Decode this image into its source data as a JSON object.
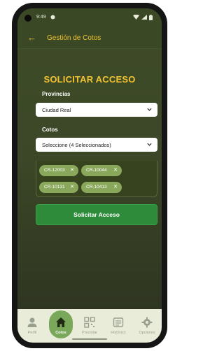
{
  "status_bar": {
    "time": "9:49",
    "network_icon": "signal-icon",
    "battery_icon": "battery-icon"
  },
  "app_bar": {
    "title": "Gestión de Cotos",
    "back_icon": "arrow-left-icon"
  },
  "form": {
    "headline": "SOLICITAR ACCESO",
    "provincias_label": "Provincias",
    "provincia_value": "Ciudad Real",
    "cotos_label": "Cotos",
    "cotos_value": "Seleccione (4 Seleccionados)",
    "selected_cotos": [
      "CR-12003",
      "CR-10044",
      "CR-10131",
      "CR-10413"
    ],
    "submit_label": "Solicitar Acceso"
  },
  "bottom_nav": {
    "items": [
      {
        "label": "Perfil",
        "icon": "person-icon",
        "active": false
      },
      {
        "label": "Cotos",
        "icon": "home-icon",
        "active": true
      },
      {
        "label": "Precintar",
        "icon": "qr-code-icon",
        "active": false
      },
      {
        "label": "Histórico",
        "icon": "history-icon",
        "active": false
      },
      {
        "label": "Opciones",
        "icon": "gear-icon",
        "active": false
      }
    ]
  },
  "colors": {
    "accent": "#f1c232",
    "background": "#3b4727",
    "submit_button": "#2e8b3a",
    "chip": "#8aa85c",
    "nav_active": "#79a85a"
  }
}
